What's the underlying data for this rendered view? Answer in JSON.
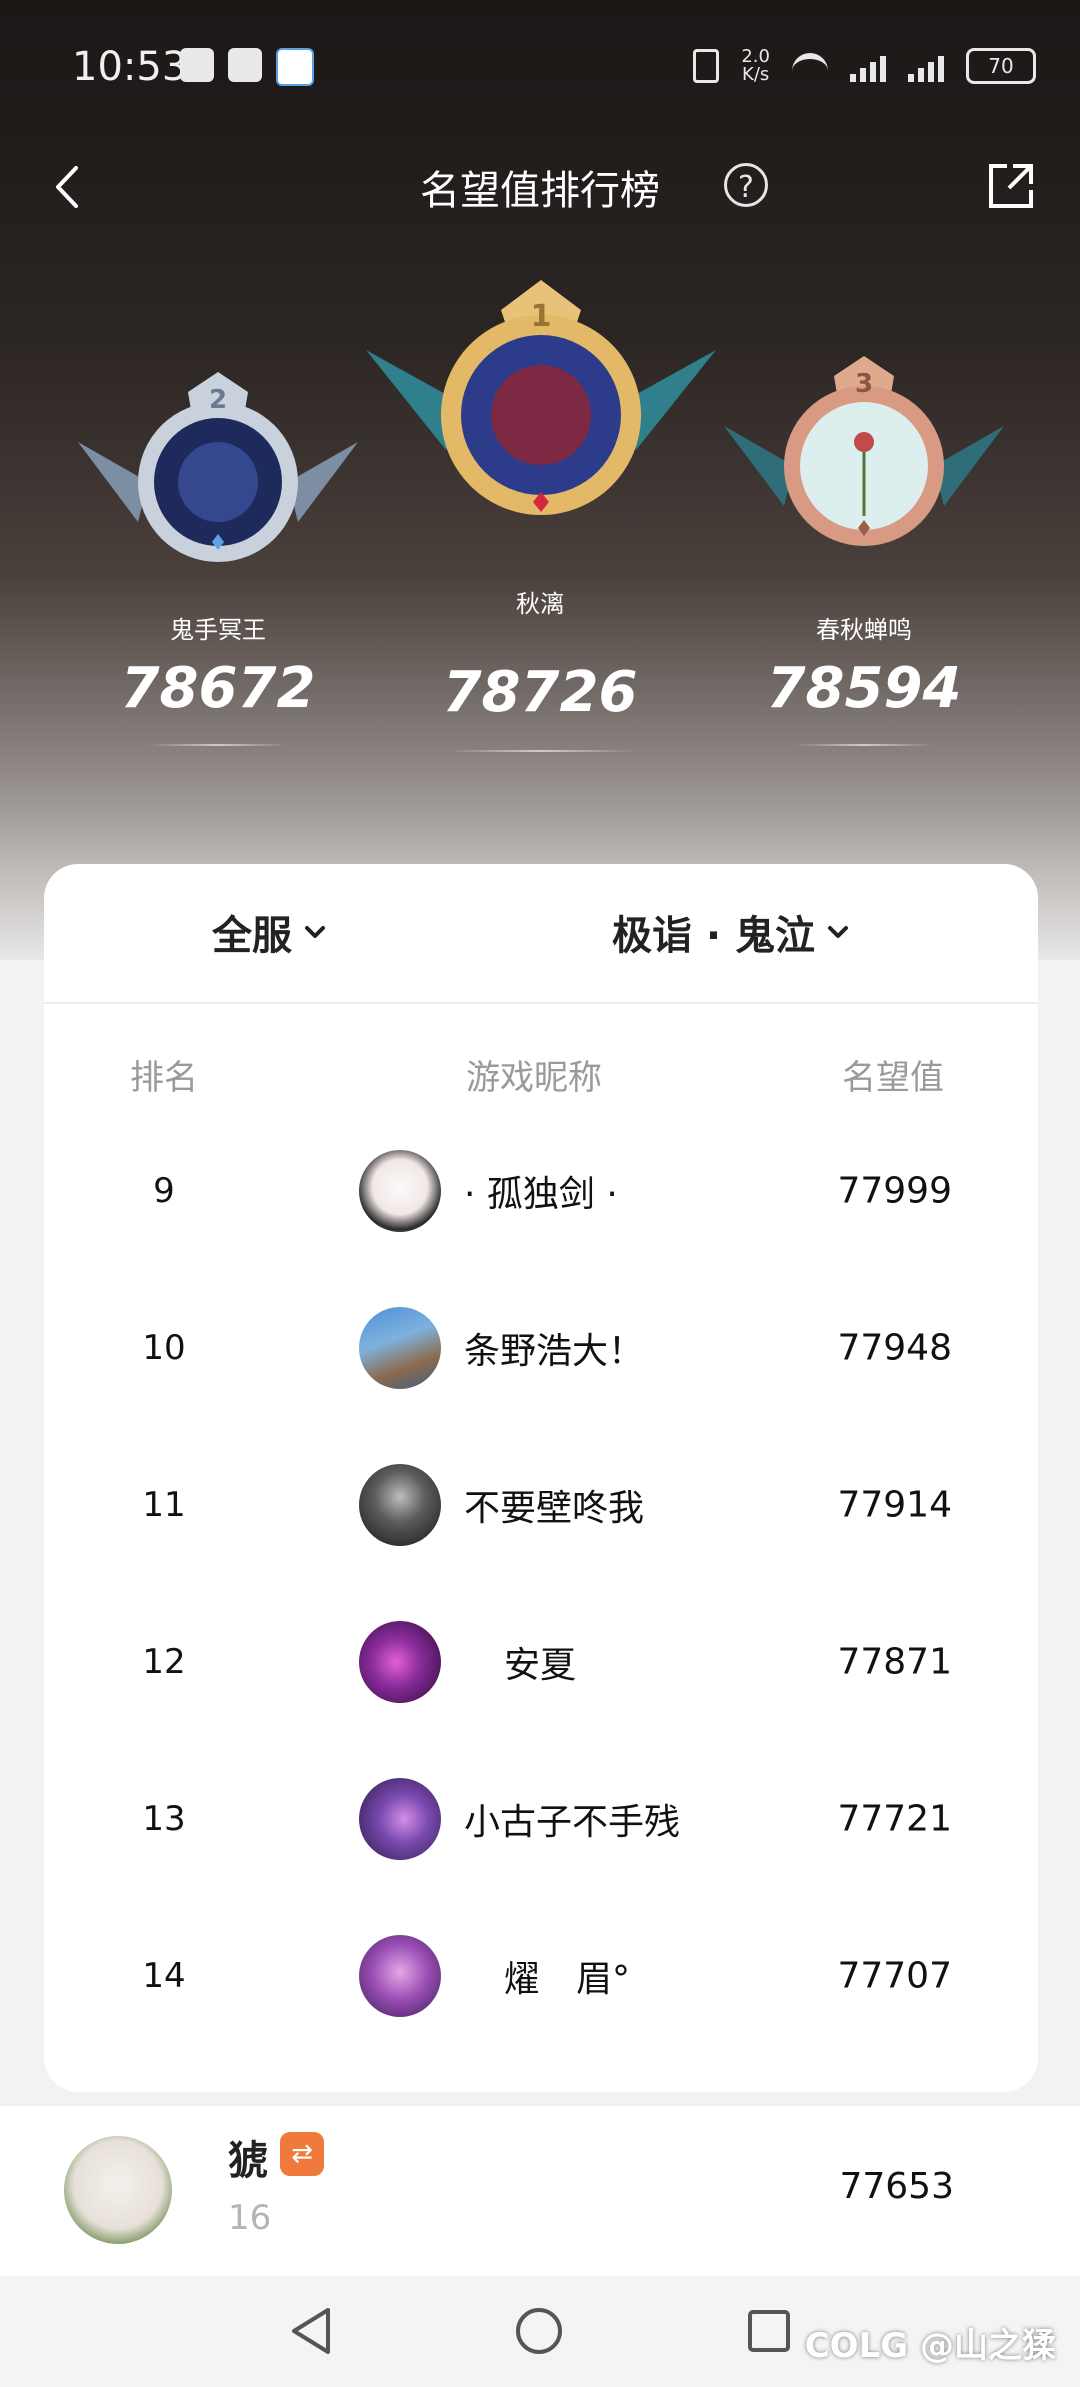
{
  "status_bar": {
    "time": "10:53",
    "net_speed_value": "2.0",
    "net_speed_unit": "K/s",
    "battery": "70"
  },
  "header": {
    "title": "名望值排行榜"
  },
  "podium": [
    {
      "rank": "2",
      "name": "鬼手冥王",
      "score": "78672",
      "color": "#b9c3d1"
    },
    {
      "rank": "1",
      "name": "秋漓",
      "score": "78726",
      "color": "#e3b968"
    },
    {
      "rank": "3",
      "name": "春秋蝉鸣",
      "score": "78594",
      "color": "#d89a82"
    }
  ],
  "filters": {
    "server": "全服",
    "region": "极诣 · 鬼泣"
  },
  "table": {
    "columns": {
      "rank": "排名",
      "nickname": "游戏昵称",
      "score": "名望值"
    },
    "rows": [
      {
        "rank": "9",
        "nickname": "· 孤独剑 ·",
        "score": "77999"
      },
      {
        "rank": "10",
        "nickname": "条野浩大！",
        "score": "77948"
      },
      {
        "rank": "11",
        "nickname": "不要壁咚我",
        "score": "77914"
      },
      {
        "rank": "12",
        "nickname": "安夏",
        "score": "77871"
      },
      {
        "rank": "13",
        "nickname": "小古子不手残",
        "score": "77721"
      },
      {
        "rank": "14",
        "nickname": "燿　眉°",
        "score": "77707"
      }
    ]
  },
  "me": {
    "name": "猇",
    "rank": "16",
    "score": "77653"
  },
  "watermark": "COLG @山之猱"
}
